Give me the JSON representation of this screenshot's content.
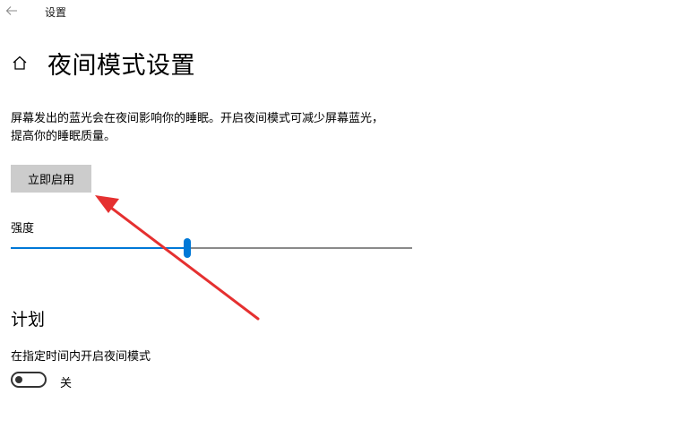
{
  "window": {
    "title": "设置",
    "back_icon": "arrow-left-icon"
  },
  "header": {
    "home_icon": "home-icon",
    "title": "夜间模式设置"
  },
  "description": {
    "line1": "屏幕发出的蓝光会在夜间影响你的睡眠。开启夜间模式可减少屏幕蓝光，",
    "line2": "提高你的睡眠质量。"
  },
  "enable_button": {
    "label": "立即启用"
  },
  "strength": {
    "label": "强度",
    "value_percent": 44
  },
  "schedule": {
    "section_title": "计划",
    "toggle_label": "在指定时间内开启夜间模式",
    "toggle_state": "关",
    "toggle_on": false
  },
  "colors": {
    "accent": "#0078d7",
    "button_bg": "#cccccc",
    "annotation_arrow": "#e53030"
  }
}
